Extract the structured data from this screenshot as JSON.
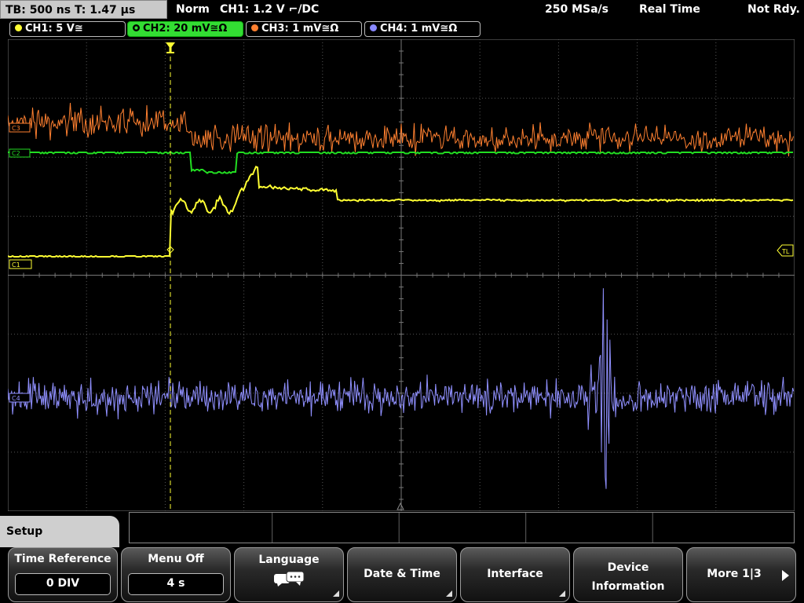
{
  "status_bar": {
    "timebase": "TB: 500 ns   T: 1.47 µs",
    "mode": "Norm",
    "trigger": "CH1: 1.2 V ⌐/DC",
    "sample_rate": "250 MSa/s",
    "acq_mode": "Real Time",
    "state": "Not Rdy."
  },
  "channels": [
    {
      "label": "CH1: 5 V≅",
      "color": "#ffff33"
    },
    {
      "label": "CH2: 20 mV≅Ω",
      "color": "#33dd33",
      "active": true
    },
    {
      "label": "CH3: 1 mV≅Ω",
      "color": "#ff8030"
    },
    {
      "label": "CH4: 1 mV≅Ω",
      "color": "#8888ff"
    }
  ],
  "waveform_labels": {
    "c1": "C1",
    "c2": "C2",
    "c3": "C3",
    "c4": "C4",
    "trigger_level": "TL"
  },
  "colors": {
    "ch1": "#ffff33",
    "ch2": "#22dd22",
    "ch3": "#ff8030",
    "ch4": "#9090ff",
    "grid": "#555555"
  },
  "menu": {
    "title": "Setup",
    "softkeys": [
      {
        "label": "Time Reference",
        "value": "0 DIV"
      },
      {
        "label": "Menu Off",
        "value": "4 s"
      },
      {
        "label": "Language"
      },
      {
        "label": "Date & Time"
      },
      {
        "label": "Interface"
      },
      {
        "label": "Device Information"
      },
      {
        "label": "More 1|3"
      }
    ]
  }
}
